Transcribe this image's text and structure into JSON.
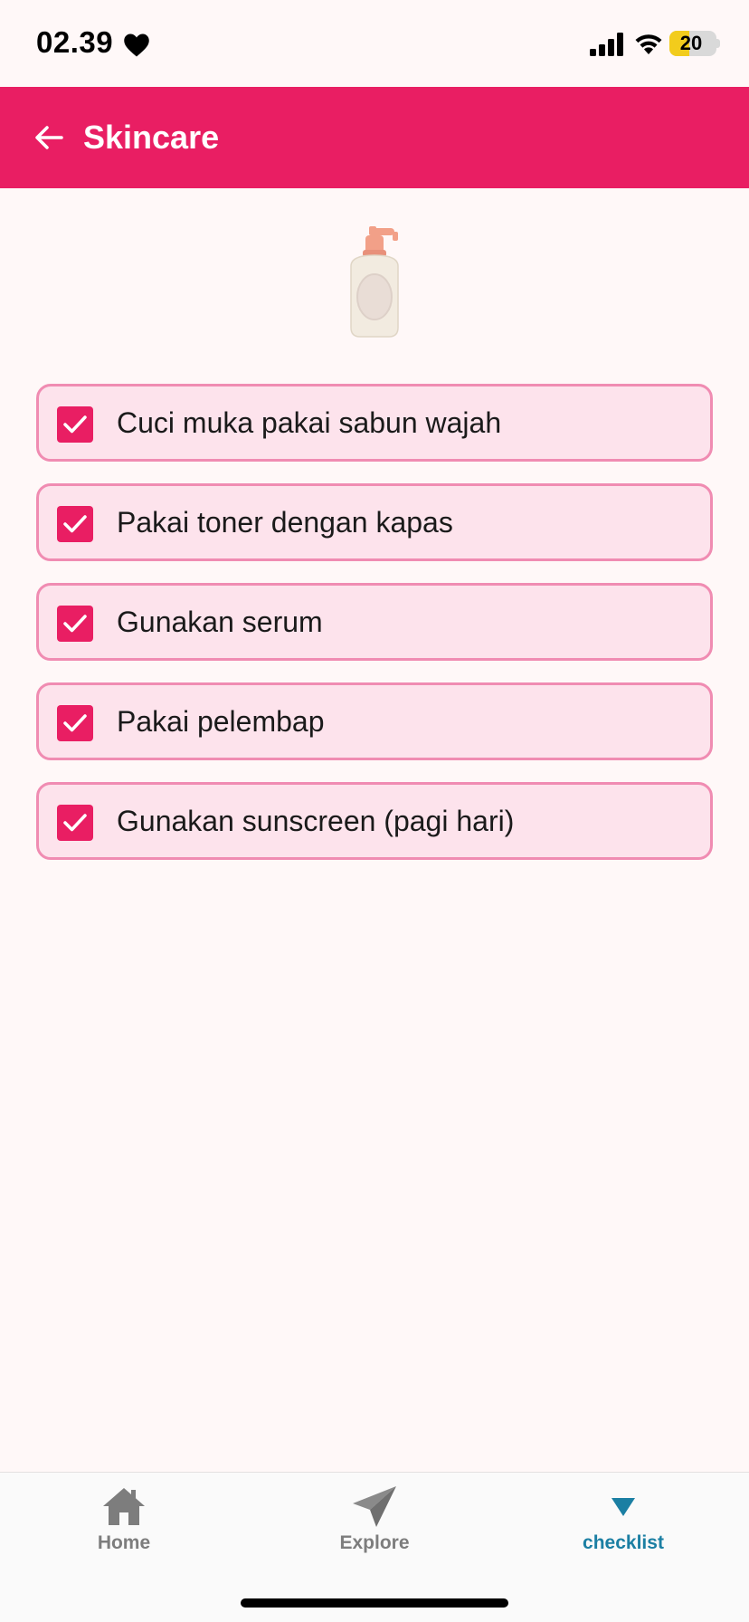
{
  "status_bar": {
    "time": "02.39",
    "battery": "20",
    "icons": [
      "heart-icon",
      "signal-icon",
      "wifi-icon",
      "battery-icon"
    ]
  },
  "app_bar": {
    "title": "Skincare",
    "back_icon": "arrow-left-icon"
  },
  "hero_icon": "lotion-bottle-icon",
  "checklist": [
    {
      "label": "Cuci muka pakai sabun wajah",
      "checked": true
    },
    {
      "label": "Pakai toner dengan kapas",
      "checked": true
    },
    {
      "label": "Gunakan serum",
      "checked": true
    },
    {
      "label": "Pakai pelembap",
      "checked": true
    },
    {
      "label": "Gunakan sunscreen (pagi hari)",
      "checked": true
    }
  ],
  "bottom_nav": {
    "items": [
      {
        "label": "Home",
        "icon": "home-icon",
        "active": false
      },
      {
        "label": "Explore",
        "icon": "paper-plane-icon",
        "active": false
      },
      {
        "label": "checklist",
        "icon": "triangle-down-icon",
        "active": true
      }
    ]
  },
  "colors": {
    "primary": "#e91e63",
    "item_bg": "#fde3ec",
    "item_border": "#f08cb2",
    "nav_active": "#1b7fa3",
    "nav_inactive": "#7d7d7d",
    "background": "#fff8f8"
  }
}
